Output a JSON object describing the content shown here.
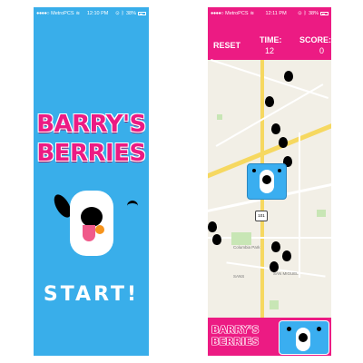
{
  "left_screen": {
    "status": {
      "carrier": "MetroPCS",
      "time": "12:10 PM",
      "battery": "38%"
    },
    "logo": {
      "line1": "BARRY'S",
      "line2": "BERRIES"
    },
    "start_label": "START!"
  },
  "right_screen": {
    "status": {
      "carrier": "MetroPCS",
      "time": "12:11 PM",
      "battery": "38%"
    },
    "reset_label": "RESET",
    "time_label": "TIME:",
    "time_value": "12",
    "score_label": "SCORE:",
    "score_value": "0",
    "map": {
      "highway": "101",
      "labels": [
        "Columbia Park",
        "SAN MIGUEL",
        "SANS"
      ]
    },
    "bottom_logo": {
      "line1": "BARRY'S",
      "line2": "BERRIES"
    }
  },
  "colors": {
    "sky_blue": "#39aeea",
    "brand_pink": "#ec1b83"
  }
}
